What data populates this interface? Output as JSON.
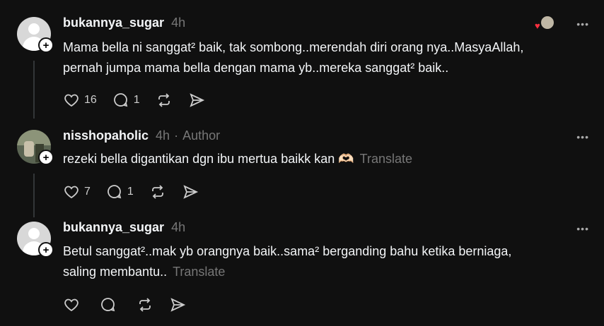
{
  "posts": [
    {
      "username": "bukannya_sugar",
      "time": "4h",
      "author_tag": "",
      "text_lines": [
        "Mama bella ni sanggat² baik, tak sombong..merendah diri orang nya..MasyaAllah,",
        "pernah jumpa mama bella dengan mama yb..mereka sanggat² baik.."
      ],
      "translate": "",
      "likes": "16",
      "replies": "1",
      "avatar": "default-avatar",
      "has_liked_avatars": true
    },
    {
      "username": "nisshopaholic",
      "time": "4h",
      "author_tag": "Author",
      "separator": "·",
      "text_lines": [
        "rezeki bella digantikan dgn ibu mertua baikk kan 🫶🏻"
      ],
      "translate": "Translate",
      "likes": "7",
      "replies": "1",
      "avatar": "photo-avatar"
    },
    {
      "username": "bukannya_sugar",
      "time": "4h",
      "author_tag": "",
      "text_lines": [
        "Betul sanggat²..mak yb orangnya baik..sama² berganding bahu ketika berniaga,",
        "saling membantu.."
      ],
      "translate": "Translate",
      "likes": "",
      "replies": "",
      "avatar": "default-avatar"
    }
  ],
  "more_icon": "•••",
  "plus_icon": "+",
  "heart_color": "#ff3040"
}
